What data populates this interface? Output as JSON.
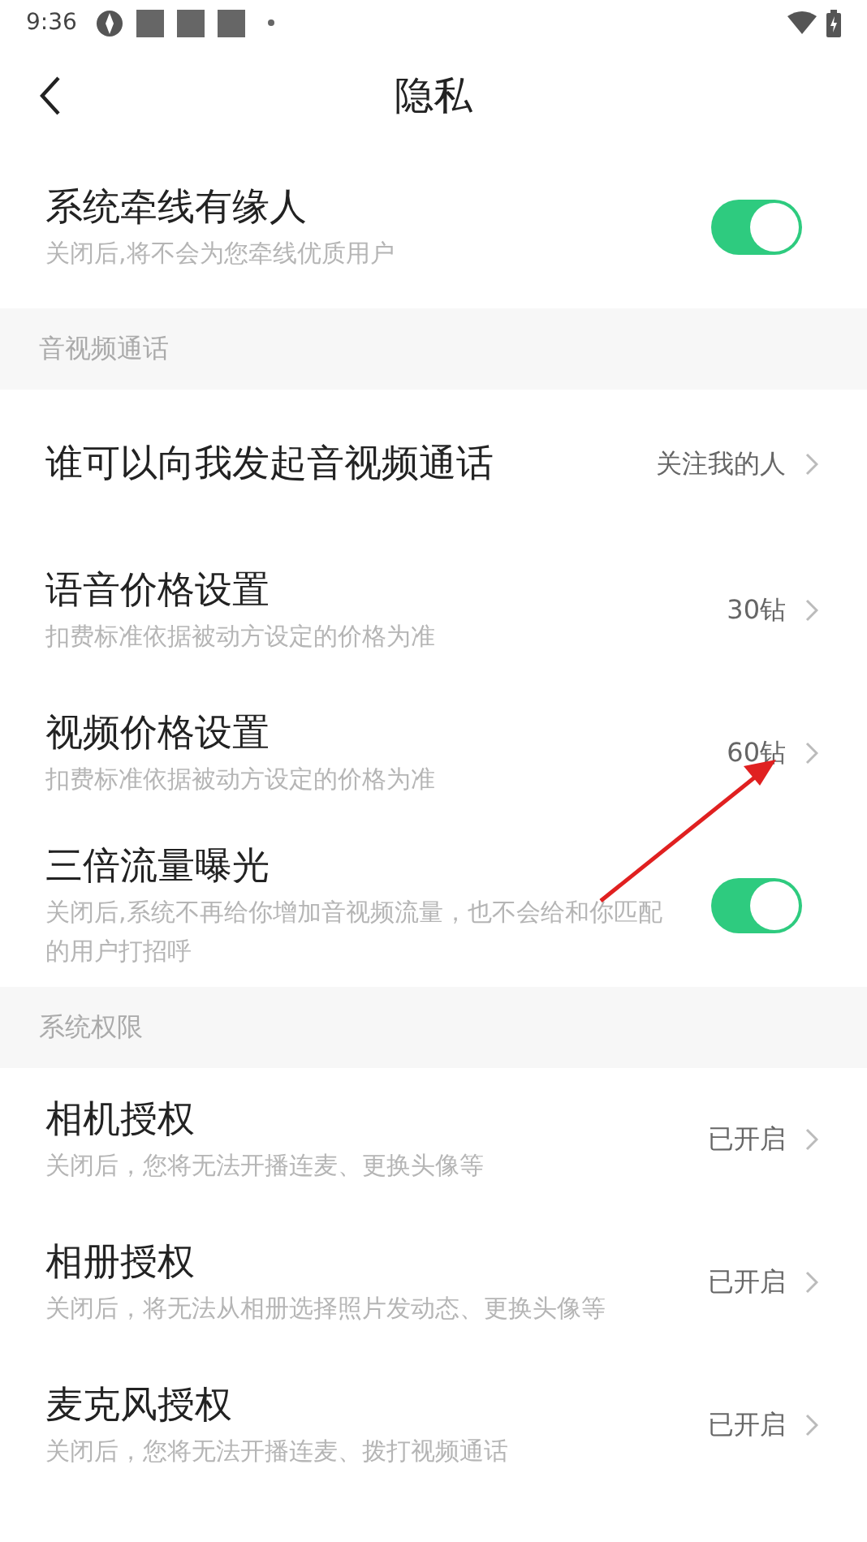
{
  "status_bar": {
    "time": "9:36"
  },
  "header": {
    "title": "隐私"
  },
  "sections": [
    {
      "rows": [
        {
          "kind": "toggle",
          "title": "系统牵线有缘人",
          "subtitle": "关闭后,将不会为您牵线优质用户",
          "on": true
        }
      ]
    },
    {
      "heading": "音视频通话",
      "rows": [
        {
          "kind": "link",
          "title": "谁可以向我发起音视频通话",
          "value": "关注我的人"
        },
        {
          "kind": "link",
          "title": "语音价格设置",
          "subtitle": "扣费标准依据被动方设定的价格为准",
          "value": "30钻"
        },
        {
          "kind": "link",
          "title": "视频价格设置",
          "subtitle": "扣费标准依据被动方设定的价格为准",
          "value": "60钻"
        },
        {
          "kind": "toggle",
          "title": "三倍流量曝光",
          "subtitle": "关闭后,系统不再给你增加音视频流量，也不会给和你匹配的用户打招呼",
          "on": true
        }
      ]
    },
    {
      "heading": "系统权限",
      "rows": [
        {
          "kind": "link",
          "title": "相机授权",
          "subtitle": "关闭后，您将无法开播连麦、更换头像等",
          "value": "已开启"
        },
        {
          "kind": "link",
          "title": "相册授权",
          "subtitle": "关闭后，将无法从相册选择照片发动态、更换头像等",
          "value": "已开启"
        },
        {
          "kind": "link",
          "title": "麦克风授权",
          "subtitle": "关闭后，您将无法开播连麦、拨打视频通话",
          "value": "已开启"
        }
      ]
    }
  ]
}
